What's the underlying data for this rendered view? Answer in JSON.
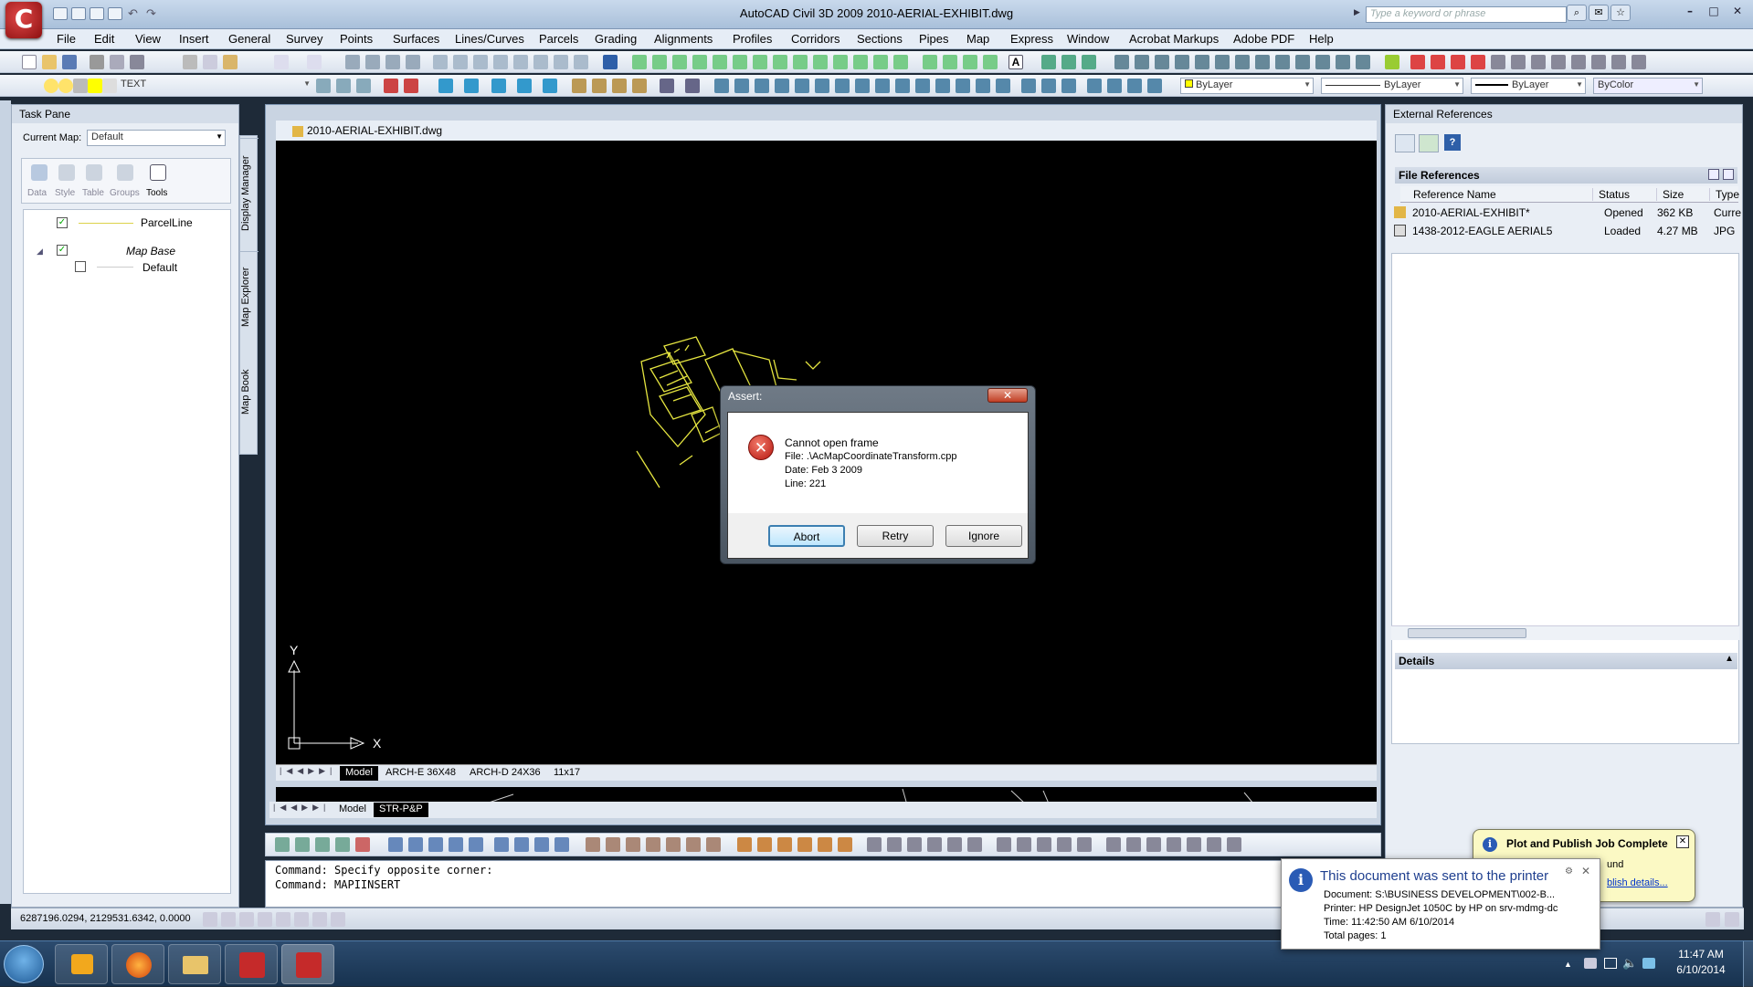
{
  "app": {
    "title": "AutoCAD Civil 3D 2009 2010-AERIAL-EXHIBIT.dwg",
    "search_placeholder": "Type a keyword or phrase",
    "logo": "C"
  },
  "menu": [
    "File",
    "Edit",
    "View",
    "Insert",
    "General",
    "Survey",
    "Points",
    "Surfaces",
    "Lines/Curves",
    "Parcels",
    "Grading",
    "Alignments",
    "Profiles",
    "Corridors",
    "Sections",
    "Pipes",
    "Map",
    "Express",
    "Window",
    "Acrobat Markups",
    "Adobe PDF",
    "Help"
  ],
  "toolbar2": {
    "layer_name": "TEXT",
    "color": "ByLayer",
    "linetype": "ByLayer",
    "lineweight": "ByLayer",
    "plotstyle": "ByColor"
  },
  "taskpane": {
    "title": "Task Pane",
    "current_map_label": "Current Map:",
    "current_map_value": "Default",
    "tools": [
      "Data",
      "Style",
      "Table",
      "Groups",
      "Tools"
    ],
    "layers": [
      {
        "name": "ParcelLine"
      },
      {
        "name": "Map Base"
      },
      {
        "name": "Default"
      }
    ],
    "vtabs": [
      "Display Manager",
      "Map Explorer",
      "Map Book"
    ]
  },
  "drawing": {
    "tab_title": "2010-AERIAL-EXHIBIT.dwg",
    "ucs_x": "X",
    "ucs_y": "Y",
    "layouts1": [
      "Model",
      "ARCH-E 36X48",
      "ARCH-D 24X36",
      "11x17"
    ],
    "layouts2": [
      "Model",
      "STR-P&P"
    ]
  },
  "dialog": {
    "title": "Assert:",
    "lines": [
      "Cannot open frame",
      "File: .\\AcMapCoordinateTransform.cpp",
      "Date: Feb  3 2009",
      "Line: 221"
    ],
    "buttons": [
      "Abort",
      "Retry",
      "Ignore"
    ]
  },
  "command": {
    "lines": [
      "Command: Specify opposite corner:",
      "Command: MAPIINSERT"
    ]
  },
  "xref": {
    "title": "External References",
    "section": "File References",
    "details": "Details",
    "columns": [
      "Reference Name",
      "Status",
      "Size",
      "Type"
    ],
    "rows": [
      {
        "name": "2010-AERIAL-EXHIBIT*",
        "status": "Opened",
        "size": "362 KB",
        "type": "Curre"
      },
      {
        "name": "1438-2012-EAGLE AERIAL5",
        "status": "Loaded",
        "size": "4.27 MB",
        "type": "JPG"
      }
    ]
  },
  "status": {
    "coords": "6287196.0294, 2129531.6342, 0.0000"
  },
  "balloon_plot": {
    "title": "Plot and Publish Job Complete",
    "frag1": "und",
    "link": "blish details..."
  },
  "balloon_print": {
    "title": "This document was sent to the printer",
    "lines": [
      "Document: S:\\BUSINESS DEVELOPMENT\\002-B...",
      "Printer: HP DesignJet 1050C by HP on srv-mdmg-dc",
      "Time: 11:42:50 AM 6/10/2014",
      "Total pages: 1"
    ]
  },
  "clock": {
    "time": "11:47 AM",
    "date": "6/10/2014"
  },
  "colors": {
    "canvas": "#000000",
    "linework": "#e6e640",
    "accent": "#c13e24"
  }
}
